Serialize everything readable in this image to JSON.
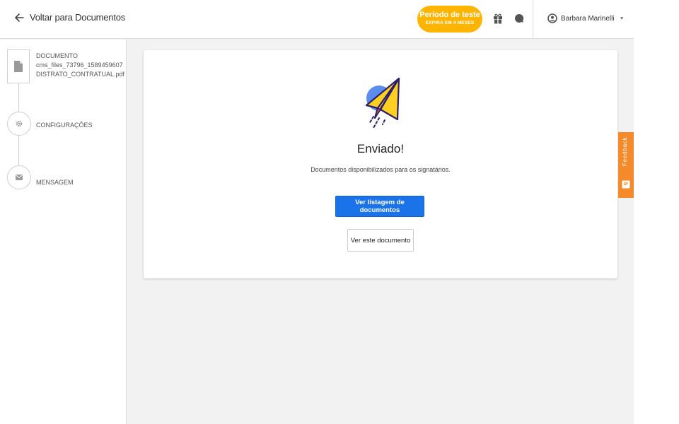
{
  "header": {
    "back_label": "Voltar para Documentos",
    "trial_title": "Período de teste",
    "trial_subtitle": "EXPIRA EM 4 MESES",
    "user_name": "Barbara Marinelli",
    "icons": [
      "arrow-left-icon",
      "gift-icon",
      "chat-icon",
      "user-circle-icon",
      "caret-down-icon"
    ]
  },
  "sidebar": {
    "steps": [
      {
        "label": "DOCUMENTO",
        "lines": [
          "cms_files_73796_1589459607",
          "DISTRATO_CONTRATUAL.pdf"
        ],
        "icon": "file-icon"
      },
      {
        "label": "CONFIGURAÇÕES",
        "icon": "gear-icon"
      },
      {
        "label": "MENSAGEM",
        "icon": "envelope-icon"
      }
    ]
  },
  "main": {
    "illustration": "paper-plane-icon",
    "title": "Enviado!",
    "subtitle": "Documentos disponibilizados para os signatários.",
    "primary_button": "Ver listagem de documentos",
    "secondary_button": "Ver este documento"
  },
  "feedback": {
    "label": "Feedback",
    "icon": "feedback-icon"
  },
  "colors": {
    "accent": "#1a73e8",
    "trial": "#ffb400",
    "feedback": "#f58a2a",
    "plane_yellow": "#ffcf22",
    "plane_blue": "#5b8def",
    "plane_outline": "#2b1f6b"
  }
}
